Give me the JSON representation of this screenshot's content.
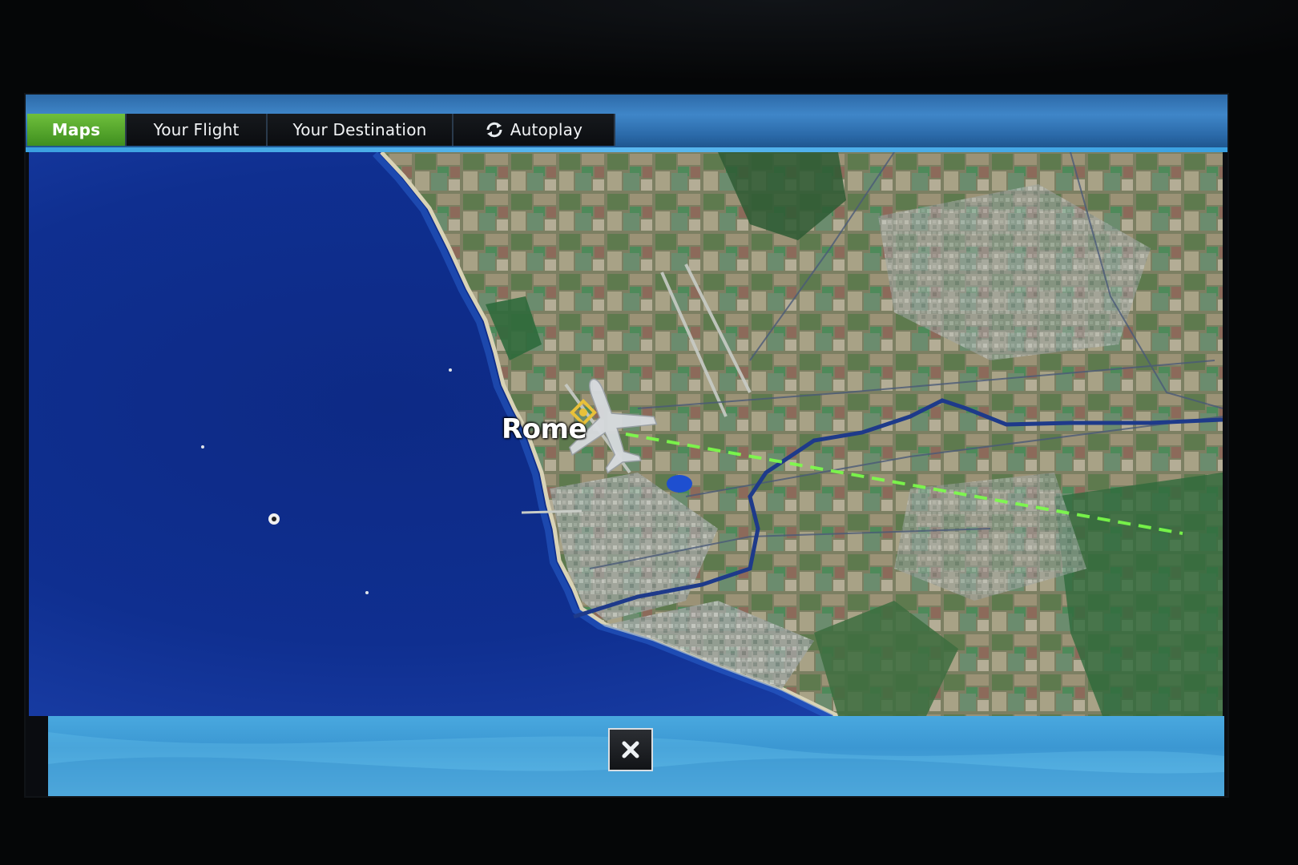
{
  "tabs": [
    {
      "label": "Maps",
      "active": true
    },
    {
      "label": "Your Flight",
      "active": false
    },
    {
      "label": "Your Destination",
      "active": false
    },
    {
      "label": "Autoplay",
      "active": false,
      "icon": "autoplay-icon"
    }
  ],
  "map": {
    "city_label": "Rome",
    "icons": [
      "airplane-icon",
      "city-marker-icon",
      "ship-icon"
    ],
    "flight_path_color": "#7cff4a",
    "sea_color": "#0f2c86",
    "land_color": "#6f7a5a"
  },
  "bottom_bar": {
    "close_icon": "close-icon"
  },
  "colors": {
    "active_tab": "#5aa82c",
    "tab_bg": "#0f1114",
    "top_bar": "#3580c0",
    "bottom_bar": "#45a2da"
  }
}
